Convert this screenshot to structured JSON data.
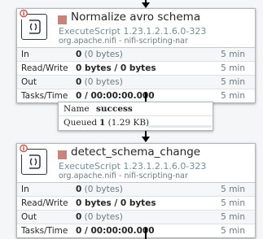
{
  "processors": [
    {
      "name": "Normalize avro schema",
      "type": "ExecuteScript 1.23.1.2.1.6.0-323",
      "bundle": "org.apache.nifi - nifi-scripting-nar",
      "stats": {
        "in": {
          "label": "In",
          "count": "0",
          "detail": "(0 bytes)",
          "time": "5 min"
        },
        "rw": {
          "label": "Read/Write",
          "value": "0 bytes / 0 bytes",
          "time": "5 min"
        },
        "out": {
          "label": "Out",
          "count": "0",
          "detail": "(0 bytes)",
          "time": "5 min"
        },
        "tasks": {
          "label": "Tasks/Time",
          "value": "0 / 00:00:00.000",
          "time": "5 min"
        }
      }
    },
    {
      "name": "detect_schema_change",
      "type": "ExecuteScript 1.23.1.2.1.6.0-323",
      "bundle": "org.apache.nifi - nifi-scripting-nar",
      "stats": {
        "in": {
          "label": "In",
          "count": "0",
          "detail": "(0 bytes)",
          "time": "5 min"
        },
        "rw": {
          "label": "Read/Write",
          "value": "0 bytes / 0 bytes",
          "time": "5 min"
        },
        "out": {
          "label": "Out",
          "count": "0",
          "detail": "(0 bytes)",
          "time": "5 min"
        },
        "tasks": {
          "label": "Tasks/Time",
          "value": "0 / 00:00:00.000",
          "time": "5 min"
        }
      }
    }
  ],
  "connection": {
    "name_label": "Name",
    "name_value": "success",
    "queued_label": "Queued",
    "queued_count": "1",
    "queued_detail": "(1.29 KB)",
    "queue_fill": 0.0
  },
  "icons": {
    "processor": "execute-script-icon",
    "warning": "invalid-warning-icon",
    "state": "stopped-state-icon"
  },
  "colors": {
    "canvas": "#f4f6f7",
    "stopped": "#c7847c",
    "warning": "#ba554a",
    "type_text": "#728e9b"
  }
}
